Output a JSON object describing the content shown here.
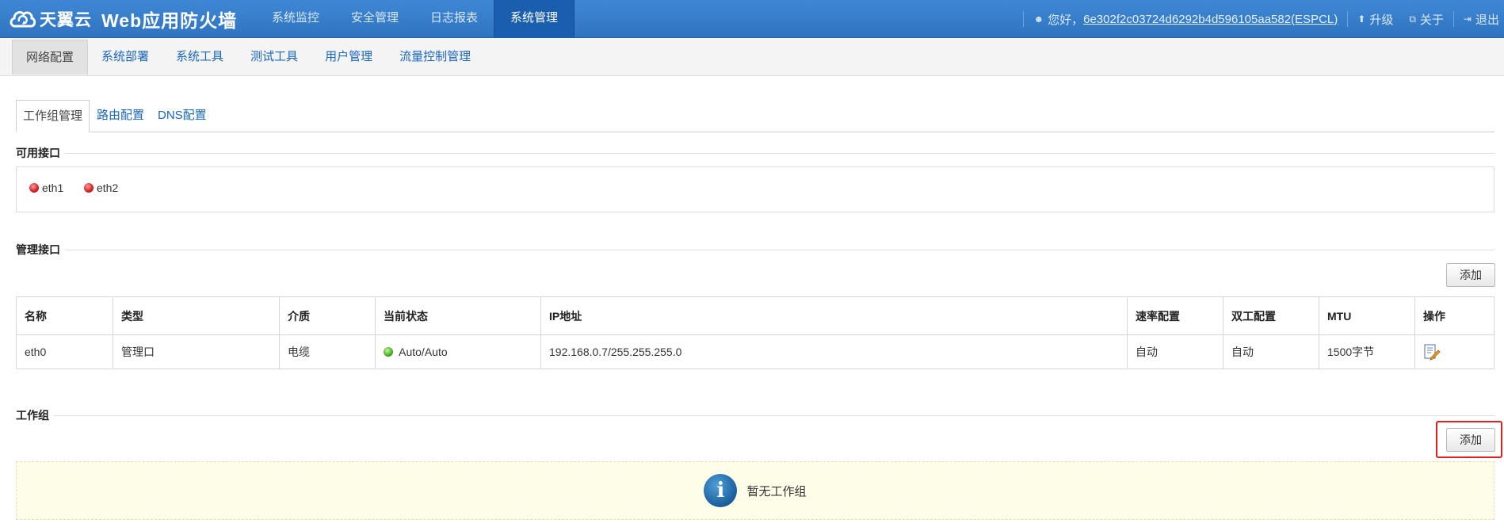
{
  "brand": {
    "company": "天翼云",
    "product": "Web应用防火墙"
  },
  "main_nav": [
    {
      "label": "系统监控",
      "active": false
    },
    {
      "label": "安全管理",
      "active": false
    },
    {
      "label": "日志报表",
      "active": false
    },
    {
      "label": "系统管理",
      "active": true
    }
  ],
  "user": {
    "greeting": "您好，",
    "name": "6e302f2c03724d6292b4d596105aa582(ESPCL)",
    "upgrade": "升级",
    "about": "关于",
    "logout": "退出"
  },
  "sub_nav": [
    {
      "label": "网络配置",
      "active": true
    },
    {
      "label": "系统部署",
      "active": false
    },
    {
      "label": "系统工具",
      "active": false
    },
    {
      "label": "测试工具",
      "active": false
    },
    {
      "label": "用户管理",
      "active": false
    },
    {
      "label": "流量控制管理",
      "active": false
    }
  ],
  "tabs": [
    {
      "label": "工作组管理",
      "active": true
    },
    {
      "label": "路由配置",
      "active": false
    },
    {
      "label": "DNS配置",
      "active": false
    }
  ],
  "available": {
    "title": "可用接口",
    "interfaces": [
      "eth1",
      "eth2"
    ]
  },
  "management": {
    "title": "管理接口",
    "add_label": "添加",
    "columns": [
      "名称",
      "类型",
      "介质",
      "当前状态",
      "IP地址",
      "速率配置",
      "双工配置",
      "MTU",
      "操作"
    ],
    "rows": [
      {
        "name": "eth0",
        "type": "管理口",
        "medium": "电缆",
        "status": "Auto/Auto",
        "ip": "192.168.0.7/255.255.255.0",
        "speed": "自动",
        "duplex": "自动",
        "mtu": "1500字节"
      }
    ]
  },
  "workgroup": {
    "title": "工作组",
    "add_label": "添加",
    "empty_message": "暂无工作组"
  },
  "colors": {
    "topbar": "#3478c6",
    "link": "#1a66c0",
    "highlight": "#e02020"
  }
}
